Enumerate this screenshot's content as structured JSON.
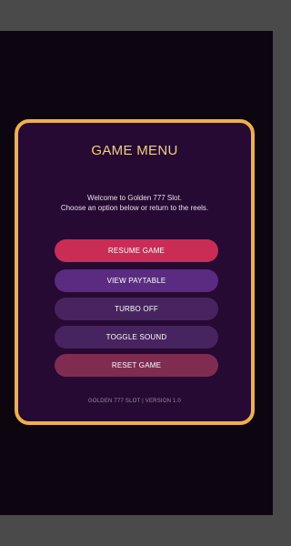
{
  "menu": {
    "title": "GAME MENU",
    "intro_line1": "Welcome to Golden 777 Slot.",
    "intro_line2": "Choose an option below or return to the reels.",
    "buttons": {
      "resume": "RESUME GAME",
      "paytable": "VIEW PAYTABLE",
      "turbo": "TURBO OFF",
      "sound": "TOGGLE SOUND",
      "reset": "RESET GAME"
    },
    "footer": "GOLDEN 777 SLOT  |  VERSION 1.0"
  },
  "colors": {
    "panel_border": "#f0b04a",
    "panel_background": "#260a33",
    "title": "#f2cf7a",
    "resume_button": "#c92d55",
    "paytable_button": "#5a2b80",
    "option_button": "#47245f",
    "reset_button": "#7f2c50"
  }
}
